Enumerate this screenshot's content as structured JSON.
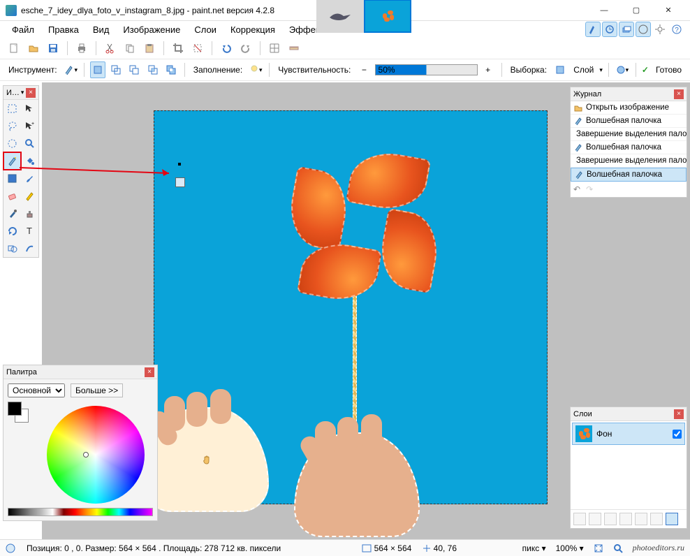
{
  "window": {
    "title": "esche_7_idey_dlya_foto_v_instagram_8.jpg - paint.net версия 4.2.8",
    "minimize": "—",
    "maximize": "▢",
    "close": "✕"
  },
  "menu": {
    "file": "Файл",
    "edit": "Правка",
    "view": "Вид",
    "image": "Изображение",
    "layers": "Слои",
    "adjust": "Коррекция",
    "effects": "Эффекты"
  },
  "toolbar2": {
    "instrument_label": "Инструмент:",
    "fill_label": "Заполнение:",
    "tolerance_label": "Чувствительность:",
    "tolerance_value": "50%",
    "sampling_label": "Выборка:",
    "sampling_value": "Слой",
    "done_label": "Готово"
  },
  "tools_panel": {
    "title": "И…"
  },
  "palette": {
    "title": "Палитра",
    "color_mode": "Основной",
    "more": "Больше >>"
  },
  "history": {
    "title": "Журнал",
    "items": [
      "Открыть изображение",
      "Волшебная палочка",
      "Завершение выделения палочкой",
      "Волшебная палочка",
      "Завершение выделения палочкой",
      "Волшебная палочка"
    ]
  },
  "layers": {
    "title": "Слои",
    "items": [
      {
        "name": "Фон",
        "visible": true
      }
    ]
  },
  "status": {
    "pos_size": "Позиция: 0 , 0. Размер: 564  × 564 . Площадь: 278 712 кв. пиксели",
    "dims": "564 × 564",
    "cursor": "40, 76",
    "units": "пикс",
    "zoom": "100%",
    "watermark": "photoeditors.ru"
  },
  "colors": {
    "accent": "#0078d7",
    "canvas_bg": "#0aa3d9",
    "highlight_red": "#e30613"
  }
}
